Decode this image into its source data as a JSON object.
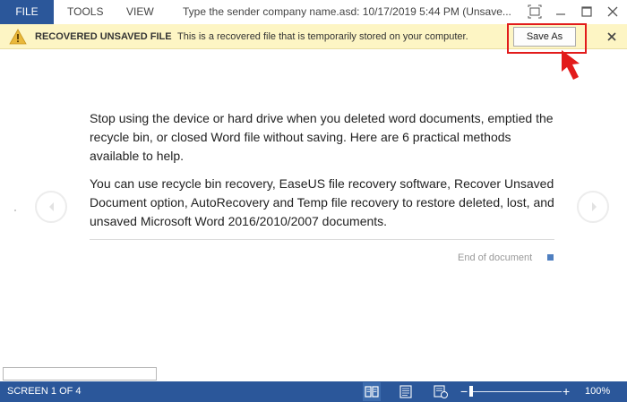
{
  "menu": {
    "file": "FILE",
    "tools": "TOOLS",
    "view": "VIEW"
  },
  "window": {
    "title": "Type the sender company name.asd: 10/17/2019 5:44 PM (Unsave..."
  },
  "message_bar": {
    "heading": "RECOVERED UNSAVED FILE",
    "text": "This is a recovered file that is temporarily stored on your computer.",
    "save_as_label": "Save As"
  },
  "document": {
    "paragraphs": [
      "Stop using the device or hard drive when you deleted word documents, emptied the recycle bin, or closed Word file without saving. Here are 6 practical methods available to help.",
      "You can use recycle bin recovery, EaseUS file recovery software, Recover Unsaved Document option, AutoRecovery and Temp file recovery to restore deleted, lost, and unsaved Microsoft Word 2016/2010/2007 documents."
    ],
    "end_label": "End of document"
  },
  "status_bar": {
    "screen": "SCREEN 1 OF 4",
    "zoom_minus": "−",
    "zoom_plus": "+",
    "zoom": "100%",
    "zoom_fraction": 0.0
  },
  "colors": {
    "accent": "#2b579a",
    "message_bar": "#fdf5c4",
    "highlight": "#e21b1b"
  },
  "icons": [
    "restore-icon",
    "minimize-icon",
    "maximize-icon",
    "close-icon",
    "warning-icon",
    "read-mode-icon",
    "print-layout-icon",
    "web-layout-icon",
    "prev-page-icon",
    "next-page-icon"
  ]
}
